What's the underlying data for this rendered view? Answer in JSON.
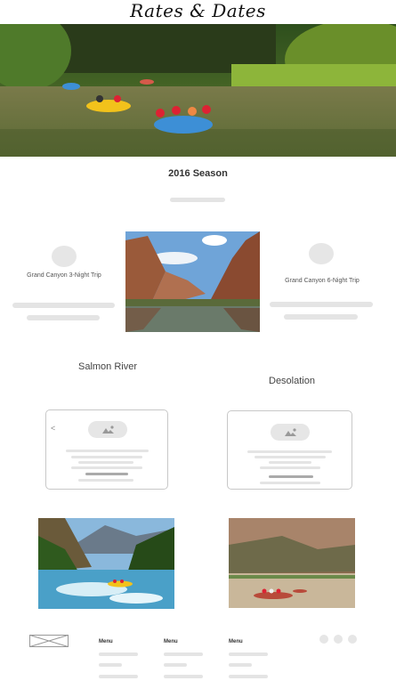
{
  "header": {
    "title": "Rates & Dates"
  },
  "season": {
    "title": "2016 Season"
  },
  "trips": [
    {
      "label": "Grand Canyon 3-Night Trip"
    },
    {
      "label": "Grand Canyon 6-Night Trip"
    }
  ],
  "rivers": [
    {
      "label": "Salmon River"
    },
    {
      "label": "Desolation"
    }
  ],
  "carousel": {
    "prev_icon": "<"
  },
  "footer": {
    "menus": [
      {
        "label": "Menu"
      },
      {
        "label": "Menu"
      },
      {
        "label": "Menu"
      }
    ]
  },
  "icons": {
    "image_placeholder": "image-placeholder-icon",
    "logo_placeholder": "logo-placeholder-icon",
    "prev": "chevron-left-icon"
  },
  "colors": {
    "raft_blue": "#3d8fd6",
    "raft_yellow": "#f2c21b",
    "placeholder_gray": "#e4e4e4",
    "card_border": "#c8c8c8"
  }
}
